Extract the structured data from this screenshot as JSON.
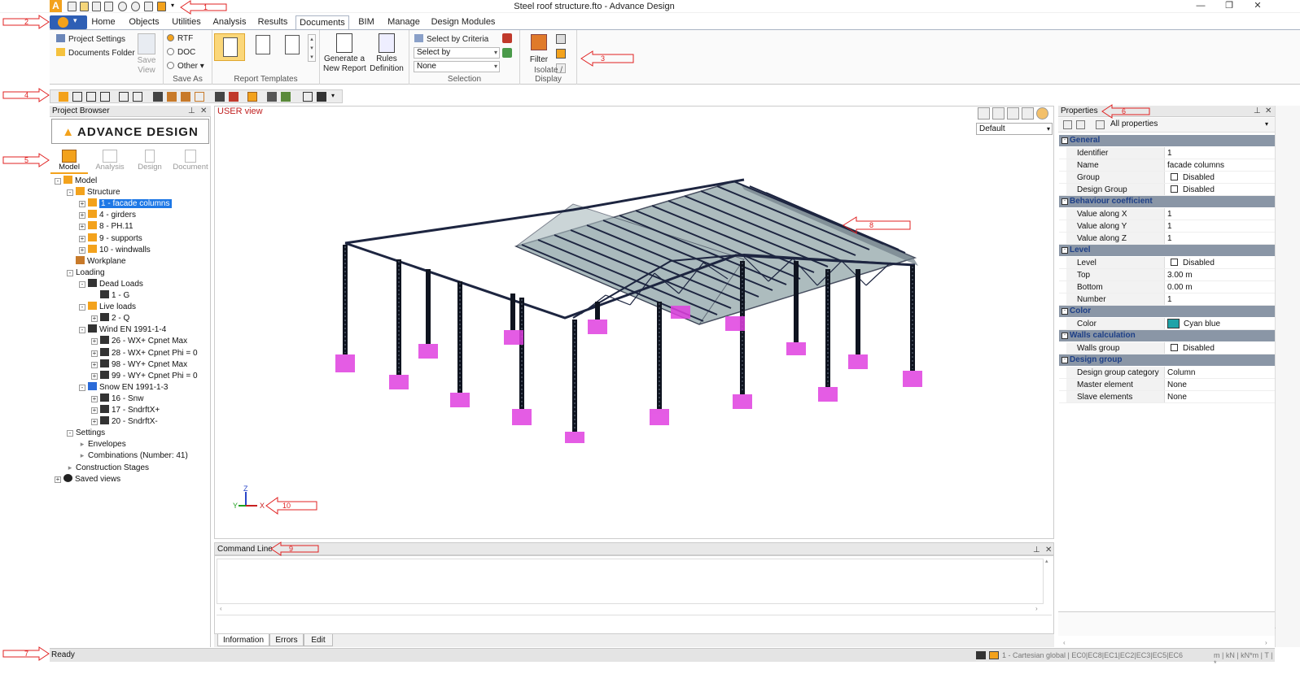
{
  "window": {
    "title": "Steel roof structure.fto - Advance Design",
    "app_letter": "A",
    "buttons": [
      "minimize",
      "restore",
      "close"
    ]
  },
  "ribbon_tabs": [
    "Home",
    "Objects",
    "Utilities",
    "Analysis",
    "Results",
    "Documents",
    "BIM",
    "Manage",
    "Design Modules"
  ],
  "active_tab": "Documents",
  "ribbon": {
    "project_settings": "Project Settings",
    "documents_folder": "Documents Folder",
    "save_view": "Save\nView",
    "save_as": {
      "rtf": "RTF",
      "doc": "DOC",
      "other": "Other",
      "label": "Save As"
    },
    "report_templates_label": "Report Templates",
    "generate_report": "Generate a\nNew Report",
    "rules_definition": "Rules\nDefinition",
    "select_by_criteria": "Select by Criteria",
    "select_by": "Select by",
    "none": "None",
    "selection_label": "Selection",
    "filter": "Filter",
    "isolate_label": "Isolate / Display"
  },
  "project_browser": {
    "title": "Project Browser",
    "logo_text": "ADVANCE DESIGN",
    "modes": [
      "Model",
      "Analysis",
      "Design",
      "Document"
    ],
    "active_mode": "Model",
    "tree": [
      {
        "label": "Model",
        "level": 0,
        "exp": "-",
        "icon": "model-icon"
      },
      {
        "label": "Structure",
        "level": 1,
        "exp": "-",
        "icon": "structure-icon"
      },
      {
        "label": "1 - facade columns",
        "level": 2,
        "exp": "+",
        "icon": "system-icon",
        "selected": true
      },
      {
        "label": "4 - girders",
        "level": 2,
        "exp": "+",
        "icon": "system-icon"
      },
      {
        "label": "8 - PH.11",
        "level": 2,
        "exp": "+",
        "icon": "system-icon"
      },
      {
        "label": "9 - supports",
        "level": 2,
        "exp": "+",
        "icon": "system-icon"
      },
      {
        "label": "10 - windwalls",
        "level": 2,
        "exp": "+",
        "icon": "system-icon"
      },
      {
        "label": "Workplane",
        "level": 1,
        "exp": "",
        "icon": "workplane-icon"
      },
      {
        "label": "Loading",
        "level": 1,
        "exp": "-",
        "icon": ""
      },
      {
        "label": "Dead Loads",
        "level": 2,
        "exp": "-",
        "icon": "dead-load-icon"
      },
      {
        "label": "1 - G",
        "level": 3,
        "exp": "",
        "icon": "load-arrow-icon"
      },
      {
        "label": "Live loads",
        "level": 2,
        "exp": "-",
        "icon": "live-load-icon"
      },
      {
        "label": "2 - Q",
        "level": 3,
        "exp": "+",
        "icon": "load-arrow-icon"
      },
      {
        "label": "Wind EN 1991-1-4",
        "level": 2,
        "exp": "-",
        "icon": "wind-icon"
      },
      {
        "label": "26 - WX+ Cpnet Max",
        "level": 3,
        "exp": "+",
        "icon": "load-arrow-icon"
      },
      {
        "label": "28 - WX+ Cpnet Phi = 0",
        "level": 3,
        "exp": "+",
        "icon": "load-arrow-icon"
      },
      {
        "label": "98 - WY+ Cpnet Max",
        "level": 3,
        "exp": "+",
        "icon": "load-arrow-icon"
      },
      {
        "label": "99 - WY+ Cpnet Phi = 0",
        "level": 3,
        "exp": "+",
        "icon": "load-arrow-icon"
      },
      {
        "label": "Snow EN 1991-1-3",
        "level": 2,
        "exp": "-",
        "icon": "snow-icon"
      },
      {
        "label": "16 - Snw",
        "level": 3,
        "exp": "+",
        "icon": "load-arrow-icon"
      },
      {
        "label": "17 - SndrftX+",
        "level": 3,
        "exp": "+",
        "icon": "load-arrow-icon"
      },
      {
        "label": "20 - SndrftX-",
        "level": 3,
        "exp": "+",
        "icon": "load-arrow-icon"
      },
      {
        "label": "Settings",
        "level": 1,
        "exp": "-",
        "icon": ""
      },
      {
        "label": "Envelopes",
        "level": 2,
        "exp": ">",
        "icon": ""
      },
      {
        "label": "Combinations (Number: 41)",
        "level": 2,
        "exp": ">",
        "icon": ""
      },
      {
        "label": "Construction Stages",
        "level": 1,
        "exp": ">",
        "icon": ""
      },
      {
        "label": "Saved views",
        "level": 0,
        "exp": "+",
        "icon": "eye-icon"
      }
    ]
  },
  "viewport": {
    "title": "USER view",
    "view_combo": "Default",
    "axes": {
      "x": "X",
      "y": "Y",
      "z": "Z"
    }
  },
  "command_line": {
    "title": "Command Line",
    "tabs": [
      "Information",
      "Errors",
      "Edit"
    ],
    "active_tab": "Information"
  },
  "properties": {
    "title": "Properties",
    "filter": "All properties",
    "sections": [
      {
        "name": "General",
        "rows": [
          {
            "name": "Identifier",
            "value": "1"
          },
          {
            "name": "Name",
            "value": "facade columns"
          },
          {
            "name": "Group",
            "value": "Disabled",
            "checkbox": true
          },
          {
            "name": "Design Group",
            "value": "Disabled",
            "checkbox": true
          }
        ]
      },
      {
        "name": "Behaviour coefficient",
        "rows": [
          {
            "name": "Value along X",
            "value": "1"
          },
          {
            "name": "Value along Y",
            "value": "1"
          },
          {
            "name": "Value along Z",
            "value": "1"
          }
        ]
      },
      {
        "name": "Level",
        "rows": [
          {
            "name": "Level",
            "value": "Disabled",
            "checkbox": true
          },
          {
            "name": "Top",
            "value": "3.00 m"
          },
          {
            "name": "Bottom",
            "value": "0.00 m"
          },
          {
            "name": "Number",
            "value": "1"
          }
        ]
      },
      {
        "name": "Color",
        "rows": [
          {
            "name": "Color",
            "value": "Cyan blue",
            "swatch": "#1fa3a8"
          }
        ]
      },
      {
        "name": "Walls calculation",
        "rows": [
          {
            "name": "Walls group",
            "value": "Disabled",
            "checkbox": true
          }
        ]
      },
      {
        "name": "Design group",
        "rows": [
          {
            "name": "Design group category",
            "value": "Column"
          },
          {
            "name": "Master element",
            "value": "None"
          },
          {
            "name": "Slave elements",
            "value": "None"
          }
        ]
      }
    ]
  },
  "status": {
    "text": "Ready",
    "coord": "1 - Cartesian global | EC0|EC8|EC1|EC2|EC3|EC5|EC6",
    "units": "m | kN | kN*m | T | *"
  },
  "callouts": [
    "1",
    "2",
    "3",
    "4",
    "5",
    "6",
    "7",
    "8",
    "9",
    "10"
  ],
  "colors": {
    "accent": "#f3a21c",
    "callout": "#e02020",
    "selection": "#1e78e6",
    "category_bg": "#8a96a6",
    "category_text": "#1d3f87",
    "support_magenta": "#e040e0"
  }
}
